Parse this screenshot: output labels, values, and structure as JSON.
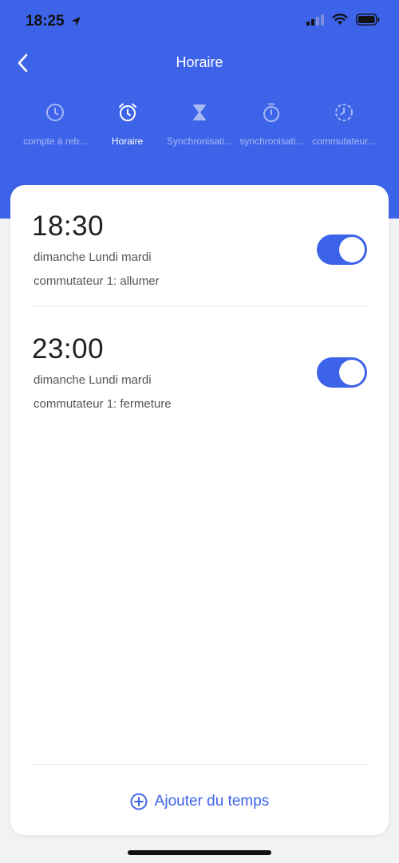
{
  "status_bar": {
    "time": "18:25",
    "icons": [
      "location-arrow-icon",
      "cellular-signal-icon",
      "wifi-icon",
      "battery-icon"
    ]
  },
  "navbar": {
    "title": "Horaire",
    "back_icon": "chevron-left-icon"
  },
  "tabs": [
    {
      "label": "compte à reb...",
      "icon": "clock-icon",
      "active": false
    },
    {
      "label": "Horaire",
      "icon": "alarm-clock-icon",
      "active": true
    },
    {
      "label": "Synchronisati...",
      "icon": "hourglass-icon",
      "active": false
    },
    {
      "label": "synchronisati...",
      "icon": "stopwatch-icon",
      "active": false
    },
    {
      "label": "commutateur...",
      "icon": "dashed-clock-icon",
      "active": false
    }
  ],
  "schedules": [
    {
      "time": "18:30",
      "days": "dimanche Lundi mardi",
      "action": "commutateur 1: allumer",
      "enabled": true
    },
    {
      "time": "23:00",
      "days": "dimanche Lundi mardi",
      "action": "commutateur 1: fermeture",
      "enabled": true
    }
  ],
  "footer": {
    "add_label": "Ajouter du temps",
    "add_icon": "plus-circle-icon"
  },
  "colors": {
    "accent": "#3d63e8",
    "background": "#f2f2f4",
    "card": "#ffffff"
  }
}
